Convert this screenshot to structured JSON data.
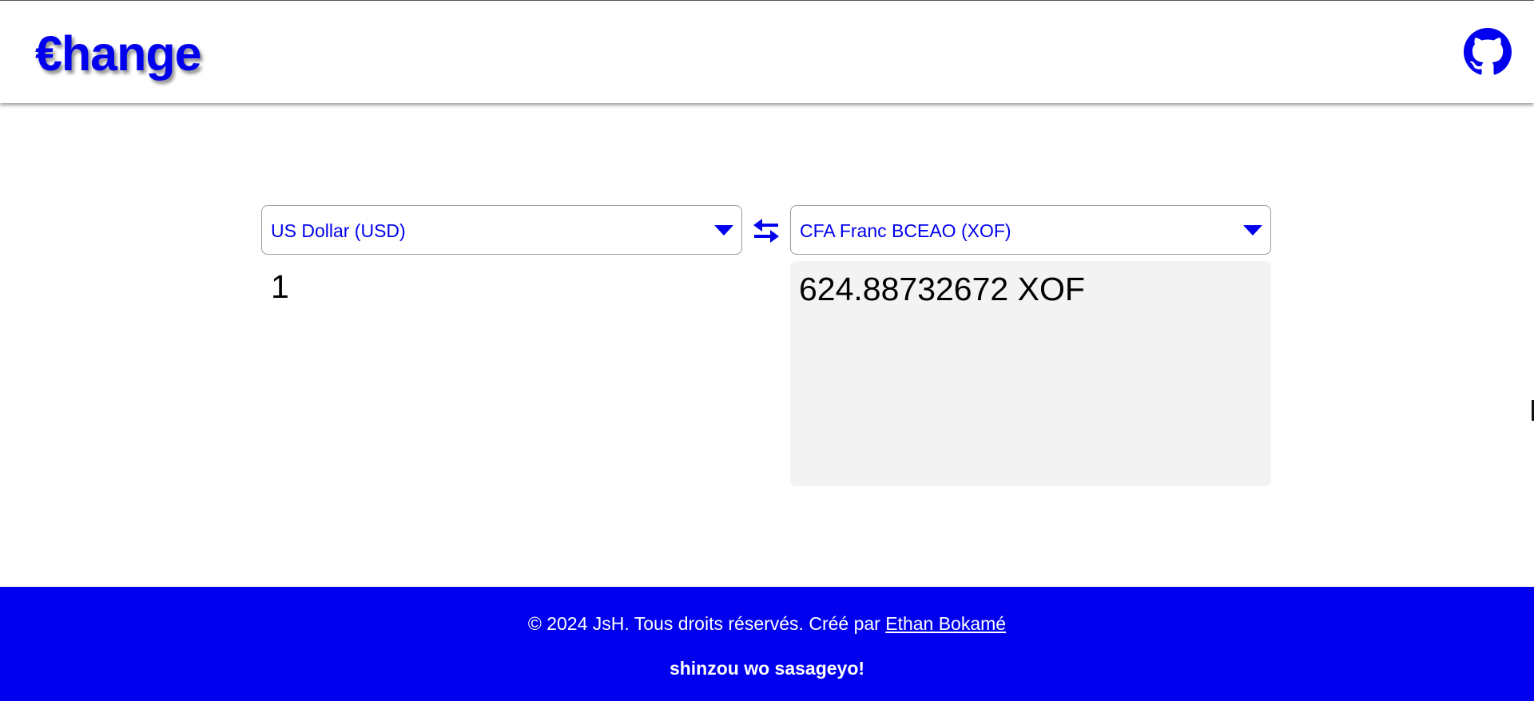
{
  "header": {
    "logo_text": "€hange",
    "github_icon": "github-icon"
  },
  "converter": {
    "from_currency": "US Dollar (USD)",
    "to_currency": "CFA Franc BCEAO (XOF)",
    "amount": "1",
    "result": "624.88732672 XOF",
    "swap_icon": "swap-arrows-icon",
    "dropdown_icon": "caret-down-icon"
  },
  "footer": {
    "copyright_prefix": "© 2024 JsH. Tous droits réservés. Créé par ",
    "author_link": "Ethan Bokamé",
    "tagline": "shinzou wo sasageyo!"
  },
  "colors": {
    "accent": "#0000ee",
    "result_bg": "#f3f3f3",
    "footer_bg": "#0000ee"
  }
}
